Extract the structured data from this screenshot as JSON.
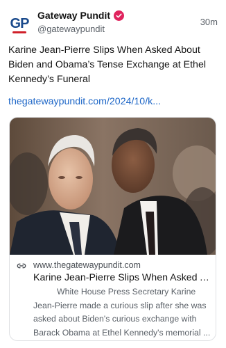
{
  "post": {
    "author": {
      "avatar_text": "GP",
      "display_name": "Gateway Pundit",
      "handle": "@gatewaypundit",
      "verified_icon": "verified-badge-icon",
      "verified_color": "#e0245e"
    },
    "time": "30m",
    "text": "Karine Jean-Pierre Slips When Asked About Biden and Obama’s Tense Exchange at Ethel Kennedy’s Funeral",
    "link_text": "thegatewaypundit.com/2024/10/k...",
    "link_color": "#1d66c7"
  },
  "card": {
    "link_icon": "link-icon",
    "domain": "www.thegatewaypundit.com",
    "title": "Karine Jean-Pierre Slips When Asked About Biden and Obama’s Tense Exchange at Ethel Kennedy’s Funeral",
    "description": "White House Press Secretary Karine Jean-Pierre made a curious slip after she was asked about Biden's curious exchange with Barack Obama at Ethel Kennedy's memorial ..."
  }
}
